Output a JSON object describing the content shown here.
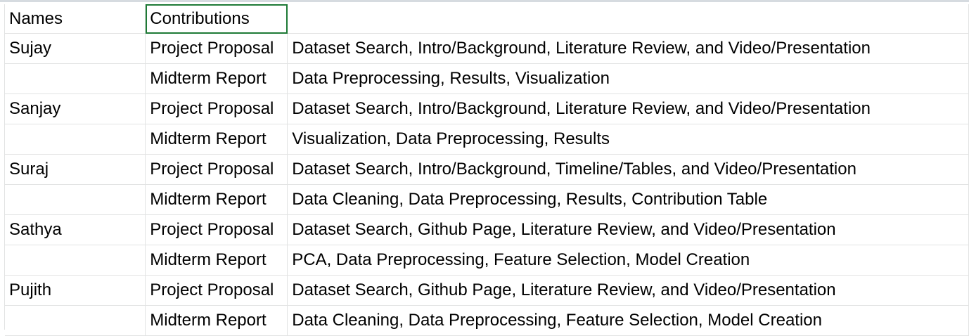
{
  "spreadsheet": {
    "header": {
      "names": "Names",
      "contributions": "Contributions"
    },
    "rows": [
      {
        "name": "Sujay",
        "phase": "Project Proposal",
        "detail": "Dataset Search, Intro/Background, Literature Review, and Video/Presentation"
      },
      {
        "name": "",
        "phase": "Midterm Report",
        "detail": "Data Preprocessing, Results, Visualization"
      },
      {
        "name": "Sanjay",
        "phase": "Project Proposal",
        "detail": "Dataset Search, Intro/Background, Literature Review, and Video/Presentation"
      },
      {
        "name": "",
        "phase": "Midterm Report",
        "detail": "Visualization, Data Preprocessing, Results"
      },
      {
        "name": "Suraj",
        "phase": "Project Proposal",
        "detail": "Dataset Search, Intro/Background, Timeline/Tables, and Video/Presentation"
      },
      {
        "name": "",
        "phase": "Midterm Report",
        "detail": "Data Cleaning, Data Preprocessing, Results, Contribution Table"
      },
      {
        "name": "Sathya",
        "phase": "Project Proposal",
        "detail": "Dataset Search, Github Page, Literature Review, and Video/Presentation"
      },
      {
        "name": "",
        "phase": "Midterm Report",
        "detail": "PCA, Data Preprocessing, Feature Selection, Model Creation"
      },
      {
        "name": "Pujith",
        "phase": "Project Proposal",
        "detail": "Dataset Search, Github Page, Literature Review, and Video/Presentation"
      },
      {
        "name": "",
        "phase": "Midterm Report",
        "detail": "Data Cleaning, Data Preprocessing, Feature Selection, Model Creation"
      }
    ]
  },
  "colors": {
    "selection": "#1e7a36",
    "gridline": "#e2e3e3",
    "text": "#000000"
  }
}
